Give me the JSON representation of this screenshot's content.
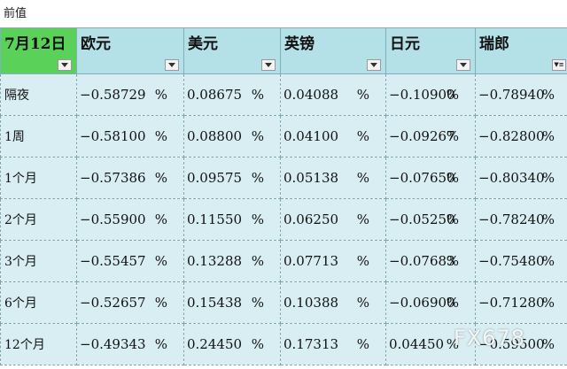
{
  "caption": "前值",
  "table": {
    "headers": [
      {
        "label": "7月12日",
        "filter": "dropdown"
      },
      {
        "label": "欧元",
        "filter": "dropdown"
      },
      {
        "label": "美元",
        "filter": "dropdown"
      },
      {
        "label": "英镑",
        "filter": "dropdown"
      },
      {
        "label": "日元",
        "filter": "dropdown"
      },
      {
        "label": "瑞郎",
        "filter": "filtered"
      }
    ],
    "unit": "%",
    "rows": [
      {
        "term": "隔夜",
        "values": [
          "-0.58729",
          "0.08675",
          "0.04088",
          "-0.10900",
          "-0.78940"
        ]
      },
      {
        "term": "1周",
        "values": [
          "-0.58100",
          "0.08800",
          "0.04100",
          "-0.09267",
          "-0.82800"
        ]
      },
      {
        "term": "1个月",
        "values": [
          "-0.57386",
          "0.09575",
          "0.05138",
          "-0.07650",
          "-0.80340"
        ]
      },
      {
        "term": "2个月",
        "values": [
          "-0.55900",
          "0.11550",
          "0.06250",
          "-0.05250",
          "-0.78240"
        ]
      },
      {
        "term": "3个月",
        "values": [
          "-0.55457",
          "0.13288",
          "0.07713",
          "-0.07683",
          "-0.75480"
        ]
      },
      {
        "term": "6个月",
        "values": [
          "-0.52657",
          "0.15438",
          "0.10388",
          "-0.06900",
          "-0.71280"
        ]
      },
      {
        "term": "12个月",
        "values": [
          "-0.49343",
          "0.24450",
          "0.17313",
          "0.04450",
          "-0.59500"
        ]
      }
    ]
  },
  "watermark": "FX678",
  "colors": {
    "date_header": "#5ad25a",
    "header": "#b4e0e8",
    "cell": "#d8eef3"
  }
}
